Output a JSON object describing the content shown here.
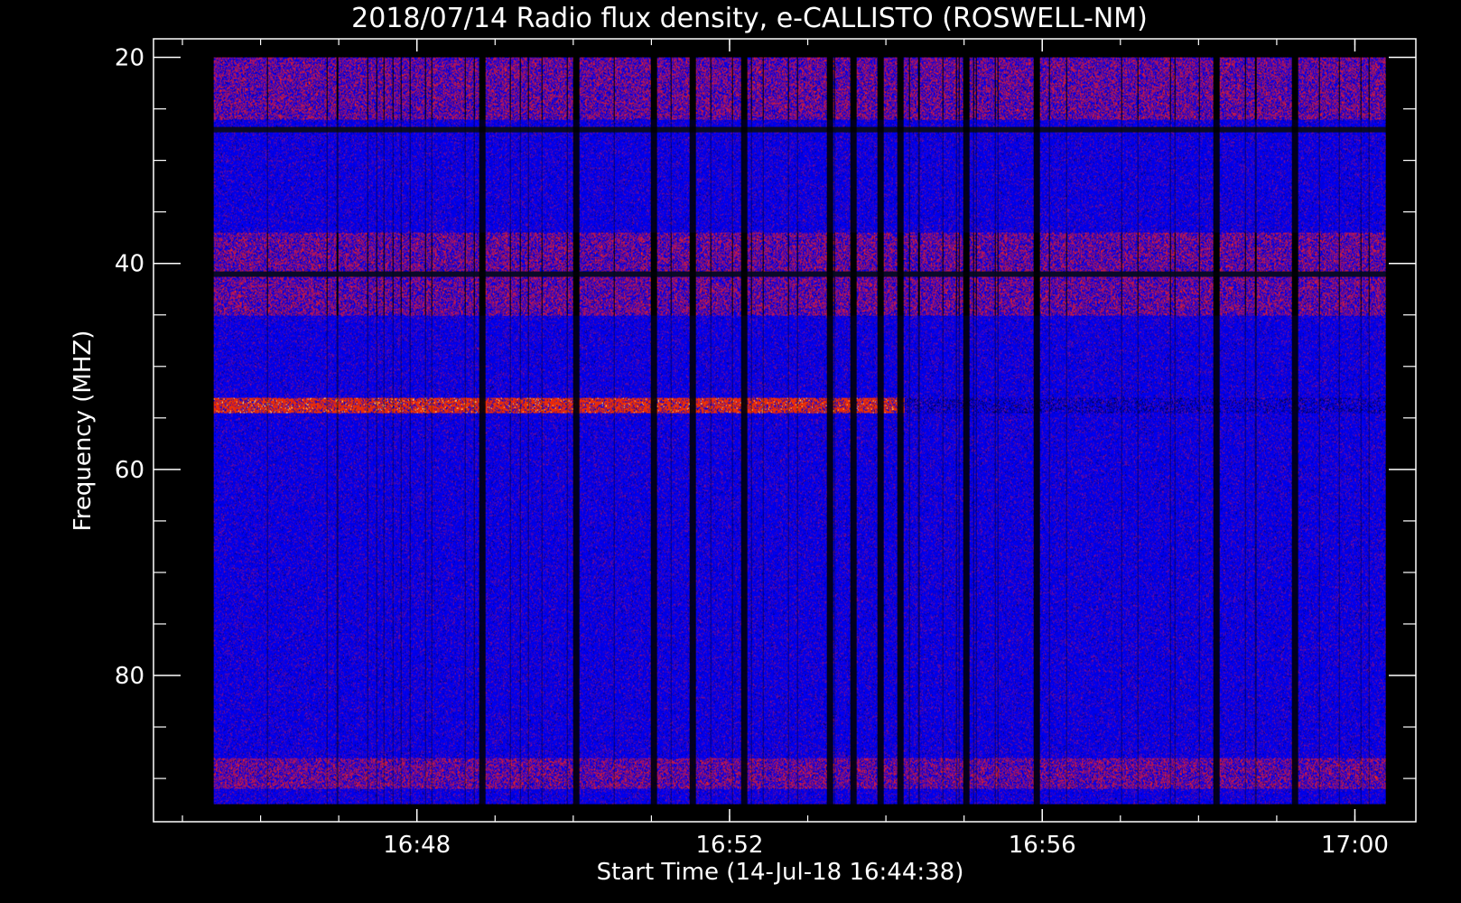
{
  "chart_data": {
    "type": "heatmap",
    "title": "2018/07/14  Radio flux density, e-CALLISTO (ROSWELL-NM)",
    "xlabel": "Start Time (14-Jul-18 16:44:38)",
    "ylabel": "Frequency (MHZ)",
    "x_ticks": [
      "16:48",
      "16:52",
      "16:56",
      "17:00"
    ],
    "x_tick_minutes": [
      3.37,
      7.37,
      11.37,
      15.37
    ],
    "x_range_minutes": [
      0,
      16.15
    ],
    "data_range_minutes": [
      0.77,
      15.77
    ],
    "y_ticks": [
      "20",
      "40",
      "60",
      "80"
    ],
    "y_tick_values": [
      20,
      40,
      60,
      80
    ],
    "y_range": [
      18.2,
      94.2
    ],
    "data_range_mhz": [
      20,
      92.5
    ],
    "y_reversed": true,
    "colors": {
      "background": "#0000ff",
      "low": "#000000",
      "medium": "#b01818",
      "high": "#ff2a00",
      "peak": "#ffff80"
    },
    "emission_bands_mhz": [
      {
        "from": 20,
        "to": 26,
        "level": "medium"
      },
      {
        "from": 37,
        "to": 45,
        "level": "medium"
      },
      {
        "from": 53,
        "to": 54.5,
        "level": "high"
      },
      {
        "from": 88,
        "to": 91,
        "level": "medium"
      }
    ],
    "interference_lines_mhz": [
      27,
      41
    ],
    "dropout_minutes": [
      4.2,
      5.4,
      6.4,
      6.9,
      7.55,
      8.65,
      8.95,
      9.3,
      9.55,
      10.4,
      11.3,
      13.6,
      14.6
    ],
    "grid": false,
    "legend": "none"
  }
}
